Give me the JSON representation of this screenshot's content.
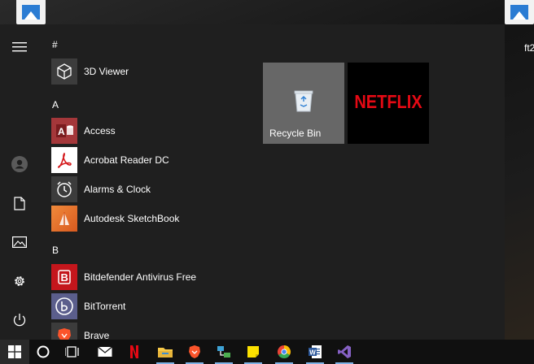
{
  "desktop": {
    "partial_label": "ft2"
  },
  "rail": {
    "items": [
      {
        "icon": "hamburger-menu-icon"
      },
      {
        "icon": "user-account-icon"
      },
      {
        "icon": "documents-icon"
      },
      {
        "icon": "pictures-icon"
      },
      {
        "icon": "settings-gear-icon"
      },
      {
        "icon": "power-icon"
      }
    ]
  },
  "app_list": {
    "groups": [
      {
        "letter": "#",
        "apps": [
          {
            "name": "3D Viewer",
            "icon": "3d-viewer-icon"
          }
        ]
      },
      {
        "letter": "A",
        "apps": [
          {
            "name": "Access",
            "icon": "access-icon"
          },
          {
            "name": "Acrobat Reader DC",
            "icon": "acrobat-icon"
          },
          {
            "name": "Alarms & Clock",
            "icon": "alarm-clock-icon"
          },
          {
            "name": "Autodesk SketchBook",
            "icon": "sketchbook-icon"
          }
        ]
      },
      {
        "letter": "B",
        "apps": [
          {
            "name": "Bitdefender Antivirus Free",
            "icon": "bitdefender-icon"
          },
          {
            "name": "BitTorrent",
            "icon": "bittorrent-icon"
          },
          {
            "name": "Brave",
            "icon": "brave-icon"
          }
        ]
      }
    ]
  },
  "tiles": {
    "recycle_bin": {
      "label": "Recycle Bin",
      "icon": "recycle-bin-icon"
    },
    "netflix": {
      "logo_text": "NETFLIX"
    }
  },
  "taskbar": {
    "items": [
      "windows-start-icon",
      "cortana-icon",
      "task-view-icon",
      "mail-icon",
      "netflix-icon",
      "file-explorer-icon",
      "brave-icon",
      "network-app-icon",
      "sticky-notes-icon",
      "chrome-icon",
      "word-icon",
      "visual-studio-icon"
    ]
  },
  "colors": {
    "start_bg": "#1f1f1f",
    "taskbar_bg": "#101010",
    "netflix_red": "#e50914",
    "recycle_tile": "#676767",
    "accent_underline": "#7fb3e6"
  }
}
